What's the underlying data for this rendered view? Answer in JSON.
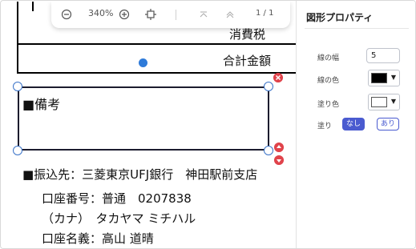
{
  "toolbar": {
    "zoom_value": "340%",
    "page_indicator": "1 / 1"
  },
  "document": {
    "tax_label": "消費税",
    "total_label": "合計金額",
    "remarks_label": "■備考",
    "transfer_line": "■振込先：三菱東京UFJ銀行　神田駅前支店",
    "account_number_line": "口座番号：普通　0207838",
    "kana_line": "（カナ）　タカヤマ ミチハル",
    "account_name_line": "口座名義：高山 道晴"
  },
  "panel": {
    "title": "図形プロパティ",
    "line_width_label": "線の幅",
    "line_width_value": "5",
    "line_color_label": "線の色",
    "line_color": "#000000",
    "fill_color_label": "塗り色",
    "fill_color": "#ffffff",
    "fill_label": "塗り",
    "fill_none_label": "なし",
    "fill_yes_label": "あり"
  },
  "colors": {
    "accent": "#4a5bd0",
    "handle_blue": "#3a73c8",
    "control_red": "#e0434b"
  }
}
